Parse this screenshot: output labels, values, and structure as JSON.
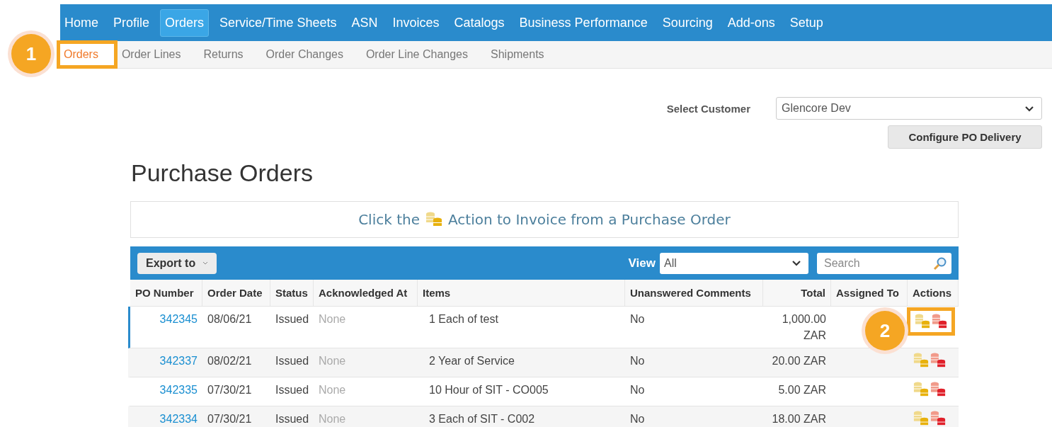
{
  "nav": [
    {
      "label": "Home",
      "selected": false
    },
    {
      "label": "Profile",
      "selected": false
    },
    {
      "label": "Orders",
      "selected": true
    },
    {
      "label": "Service/Time Sheets",
      "selected": false
    },
    {
      "label": "ASN",
      "selected": false
    },
    {
      "label": "Invoices",
      "selected": false
    },
    {
      "label": "Catalogs",
      "selected": false
    },
    {
      "label": "Business Performance",
      "selected": false
    },
    {
      "label": "Sourcing",
      "selected": false
    },
    {
      "label": "Add-ons",
      "selected": false
    },
    {
      "label": "Setup",
      "selected": false
    }
  ],
  "subnav": [
    {
      "label": "Orders",
      "selected": true,
      "highlighted": true
    },
    {
      "label": "Order Lines",
      "selected": false,
      "highlighted": false
    },
    {
      "label": "Returns",
      "selected": false,
      "highlighted": false
    },
    {
      "label": "Order Changes",
      "selected": false,
      "highlighted": false
    },
    {
      "label": "Order Line Changes",
      "selected": false,
      "highlighted": false
    },
    {
      "label": "Shipments",
      "selected": false,
      "highlighted": false
    }
  ],
  "callouts": [
    "1",
    "2"
  ],
  "customer": {
    "label": "Select Customer",
    "value": "Glencore Dev"
  },
  "configure_button": "Configure PO Delivery",
  "title": "Purchase Orders",
  "banner": {
    "before": "Click the",
    "after": "Action to Invoice from a Purchase Order"
  },
  "toolbar": {
    "export": "Export to",
    "view_label": "View",
    "view_value": "All",
    "search": {
      "placeholder": "Search"
    }
  },
  "table": {
    "columns": [
      "PO Number",
      "Order Date",
      "Status",
      "Acknowledged At",
      "Items",
      "Unanswered Comments",
      "Total",
      "Assigned To",
      "Actions"
    ],
    "rows": [
      {
        "po": "342345",
        "date": "08/06/21",
        "status": "Issued",
        "ack": "None",
        "items": "1 Each of test",
        "comments": "No",
        "total": "1,000.00 ZAR",
        "selected": true,
        "highlighted": true
      },
      {
        "po": "342337",
        "date": "08/02/21",
        "status": "Issued",
        "ack": "None",
        "items": "2 Year of Service",
        "comments": "No",
        "total": "20.00 ZAR",
        "selected": false,
        "highlighted": false
      },
      {
        "po": "342335",
        "date": "07/30/21",
        "status": "Issued",
        "ack": "None",
        "items": "10 Hour of SIT - CO005",
        "comments": "No",
        "total": "5.00 ZAR",
        "selected": false,
        "highlighted": false
      },
      {
        "po": "342334",
        "date": "07/30/21",
        "status": "Issued",
        "ack": "None",
        "items": "3 Each of SIT - C002",
        "comments": "No",
        "total": "18.00 ZAR",
        "selected": false,
        "highlighted": false
      }
    ]
  }
}
